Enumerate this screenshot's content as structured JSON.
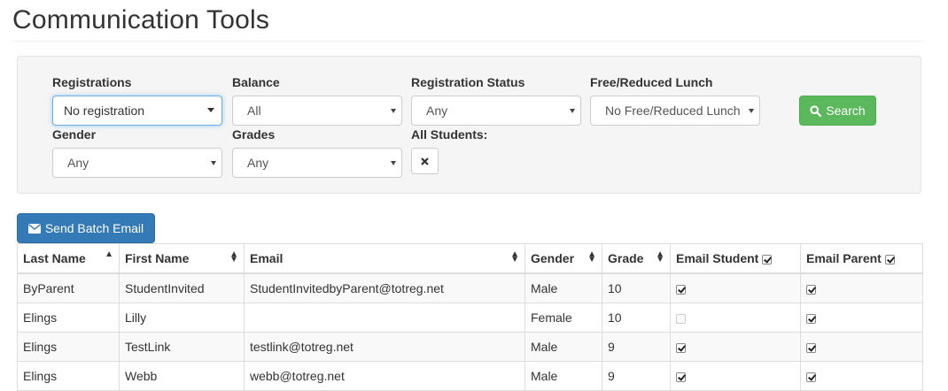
{
  "page": {
    "title": "Communication Tools"
  },
  "filters": {
    "registrations": {
      "label": "Registrations",
      "value": "No registration"
    },
    "balance": {
      "label": "Balance",
      "value": "All"
    },
    "registration_status": {
      "label": "Registration Status",
      "value": "Any"
    },
    "free_reduced_lunch": {
      "label": "Free/Reduced Lunch",
      "value": "No Free/Reduced Lunch"
    },
    "gender": {
      "label": "Gender",
      "value": "Any"
    },
    "grades": {
      "label": "Grades",
      "value": "Any"
    },
    "all_students": {
      "label": "All Students:"
    },
    "search_label": "Search"
  },
  "actions": {
    "send_batch_email": "Send Batch Email"
  },
  "table": {
    "headers": {
      "last_name": "Last Name",
      "first_name": "First Name",
      "email": "Email",
      "gender": "Gender",
      "grade": "Grade",
      "email_student": "Email Student",
      "email_parent": "Email Parent"
    },
    "rows": [
      {
        "last_name": "ByParent",
        "first_name": "StudentInvited",
        "email": "StudentInvitedbyParent@totreg.net",
        "gender": "Male",
        "grade": "10",
        "email_student": true,
        "email_parent": true
      },
      {
        "last_name": "Elings",
        "first_name": "Lilly",
        "email": "",
        "gender": "Female",
        "grade": "10",
        "email_student": false,
        "email_parent": true
      },
      {
        "last_name": "Elings",
        "first_name": "TestLink",
        "email": "testlink@totreg.net",
        "gender": "Male",
        "grade": "9",
        "email_student": true,
        "email_parent": true
      },
      {
        "last_name": "Elings",
        "first_name": "Webb",
        "email": "webb@totreg.net",
        "gender": "Male",
        "grade": "9",
        "email_student": true,
        "email_parent": true
      }
    ]
  },
  "colors": {
    "search_button": "#5cb85c",
    "batch_button": "#337ab7",
    "panel_bg": "#f5f5f5"
  }
}
